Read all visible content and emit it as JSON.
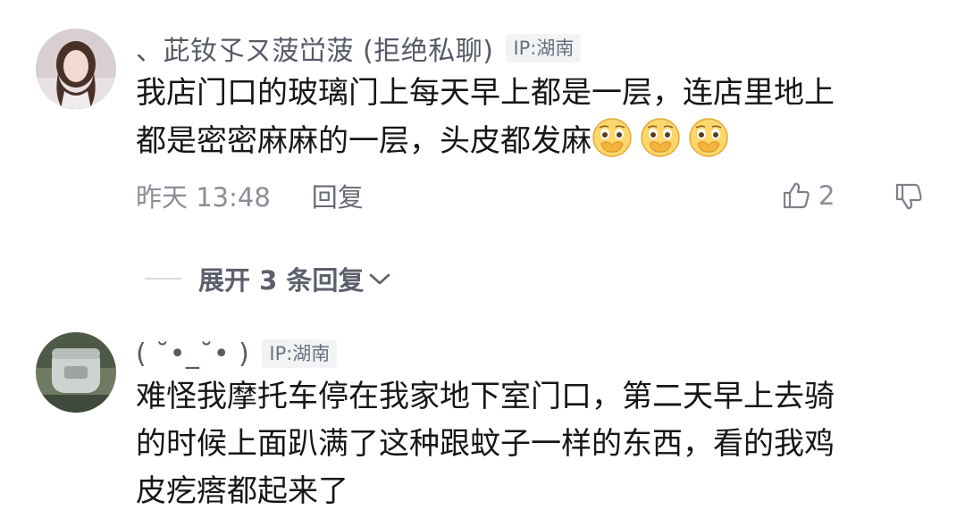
{
  "comments": [
    {
      "user_name": "、茈钕孓ㄡ菠峃菠 (拒绝私聊)",
      "ip_label": "IP:湖南",
      "text_lines": [
        "我店门口的玻璃门上每天早上都是一层，连店里地上",
        "都是密密麻麻的一层，头皮都发麻"
      ],
      "emoji_icon": "covering-mouth-crying-emoji",
      "emoji_count": 3,
      "time": "昨天 13:48",
      "reply_label": "回复",
      "like_count": "2"
    },
    {
      "user_name": "( ˘•_˘• )",
      "ip_label": "IP:湖南",
      "text_lines": [
        "难怪我摩托车停在我家地下室门口，第二天早上去骑",
        "的时候上面趴满了这种跟蚊子一样的东西，看的我鸡",
        "皮疙瘩都起来了"
      ]
    }
  ],
  "expand_replies_label": "展开 3 条回复",
  "colors": {
    "name": "#555a66",
    "meta": "#8a8d96",
    "ip_bg": "#f2f3f5"
  }
}
